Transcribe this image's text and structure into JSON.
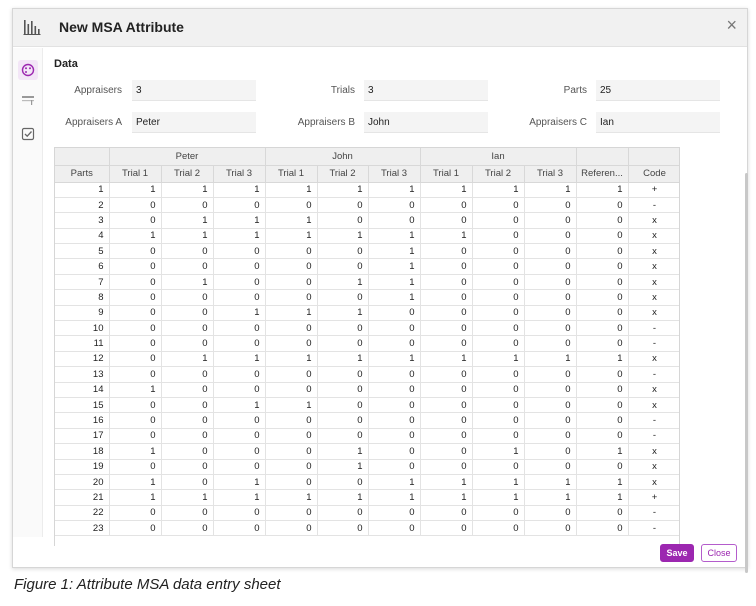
{
  "dialog": {
    "title": "New MSA Attribute",
    "close_symbol": "×",
    "icons": {
      "app": "bar-chart-icon",
      "nav": [
        "palette-icon",
        "grid-rows-icon",
        "checkbox-icon"
      ]
    }
  },
  "form": {
    "section_title": "Data",
    "appraisers_label": "Appraisers",
    "appraisers_value": "3",
    "trials_label": "Trials",
    "trials_value": "3",
    "parts_label": "Parts",
    "parts_value": "25",
    "appraiser_a_label": "Appraisers A",
    "appraiser_a_value": "Peter",
    "appraiser_b_label": "Appraisers B",
    "appraiser_b_value": "John",
    "appraiser_c_label": "Appraisers C",
    "appraiser_c_value": "Ian"
  },
  "table": {
    "groups": [
      "Peter",
      "John",
      "Ian"
    ],
    "headers": [
      "Parts",
      "Trial 1",
      "Trial 2",
      "Trial 3",
      "Trial 1",
      "Trial 2",
      "Trial 3",
      "Trial 1",
      "Trial 2",
      "Trial 3",
      "Referen...",
      "Code"
    ],
    "rows": [
      [
        "1",
        "1",
        "1",
        "1",
        "1",
        "1",
        "1",
        "1",
        "1",
        "1",
        "1",
        "+"
      ],
      [
        "2",
        "0",
        "0",
        "0",
        "0",
        "0",
        "0",
        "0",
        "0",
        "0",
        "0",
        "-"
      ],
      [
        "3",
        "0",
        "1",
        "1",
        "1",
        "0",
        "0",
        "0",
        "0",
        "0",
        "0",
        "x"
      ],
      [
        "4",
        "1",
        "1",
        "1",
        "1",
        "1",
        "1",
        "1",
        "0",
        "0",
        "0",
        "x"
      ],
      [
        "5",
        "0",
        "0",
        "0",
        "0",
        "0",
        "1",
        "0",
        "0",
        "0",
        "0",
        "x"
      ],
      [
        "6",
        "0",
        "0",
        "0",
        "0",
        "0",
        "1",
        "0",
        "0",
        "0",
        "0",
        "x"
      ],
      [
        "7",
        "0",
        "1",
        "0",
        "0",
        "1",
        "1",
        "0",
        "0",
        "0",
        "0",
        "x"
      ],
      [
        "8",
        "0",
        "0",
        "0",
        "0",
        "0",
        "1",
        "0",
        "0",
        "0",
        "0",
        "x"
      ],
      [
        "9",
        "0",
        "0",
        "1",
        "1",
        "1",
        "0",
        "0",
        "0",
        "0",
        "0",
        "x"
      ],
      [
        "10",
        "0",
        "0",
        "0",
        "0",
        "0",
        "0",
        "0",
        "0",
        "0",
        "0",
        "-"
      ],
      [
        "11",
        "0",
        "0",
        "0",
        "0",
        "0",
        "0",
        "0",
        "0",
        "0",
        "0",
        "-"
      ],
      [
        "12",
        "0",
        "1",
        "1",
        "1",
        "1",
        "1",
        "1",
        "1",
        "1",
        "1",
        "x"
      ],
      [
        "13",
        "0",
        "0",
        "0",
        "0",
        "0",
        "0",
        "0",
        "0",
        "0",
        "0",
        "-"
      ],
      [
        "14",
        "1",
        "0",
        "0",
        "0",
        "0",
        "0",
        "0",
        "0",
        "0",
        "0",
        "x"
      ],
      [
        "15",
        "0",
        "0",
        "1",
        "1",
        "0",
        "0",
        "0",
        "0",
        "0",
        "0",
        "x"
      ],
      [
        "16",
        "0",
        "0",
        "0",
        "0",
        "0",
        "0",
        "0",
        "0",
        "0",
        "0",
        "-"
      ],
      [
        "17",
        "0",
        "0",
        "0",
        "0",
        "0",
        "0",
        "0",
        "0",
        "0",
        "0",
        "-"
      ],
      [
        "18",
        "1",
        "0",
        "0",
        "0",
        "1",
        "0",
        "0",
        "1",
        "0",
        "1",
        "x"
      ],
      [
        "19",
        "0",
        "0",
        "0",
        "0",
        "1",
        "0",
        "0",
        "0",
        "0",
        "0",
        "x"
      ],
      [
        "20",
        "1",
        "0",
        "1",
        "0",
        "0",
        "1",
        "1",
        "1",
        "1",
        "1",
        "x"
      ],
      [
        "21",
        "1",
        "1",
        "1",
        "1",
        "1",
        "1",
        "1",
        "1",
        "1",
        "1",
        "+"
      ],
      [
        "22",
        "0",
        "0",
        "0",
        "0",
        "0",
        "0",
        "0",
        "0",
        "0",
        "0",
        "-"
      ],
      [
        "23",
        "0",
        "0",
        "0",
        "0",
        "0",
        "0",
        "0",
        "0",
        "0",
        "0",
        "-"
      ]
    ]
  },
  "buttons": {
    "save": "Save",
    "close": "Close"
  },
  "caption": "Figure 1: Attribute MSA data entry sheet",
  "colors": {
    "accent": "#9c27b0"
  }
}
